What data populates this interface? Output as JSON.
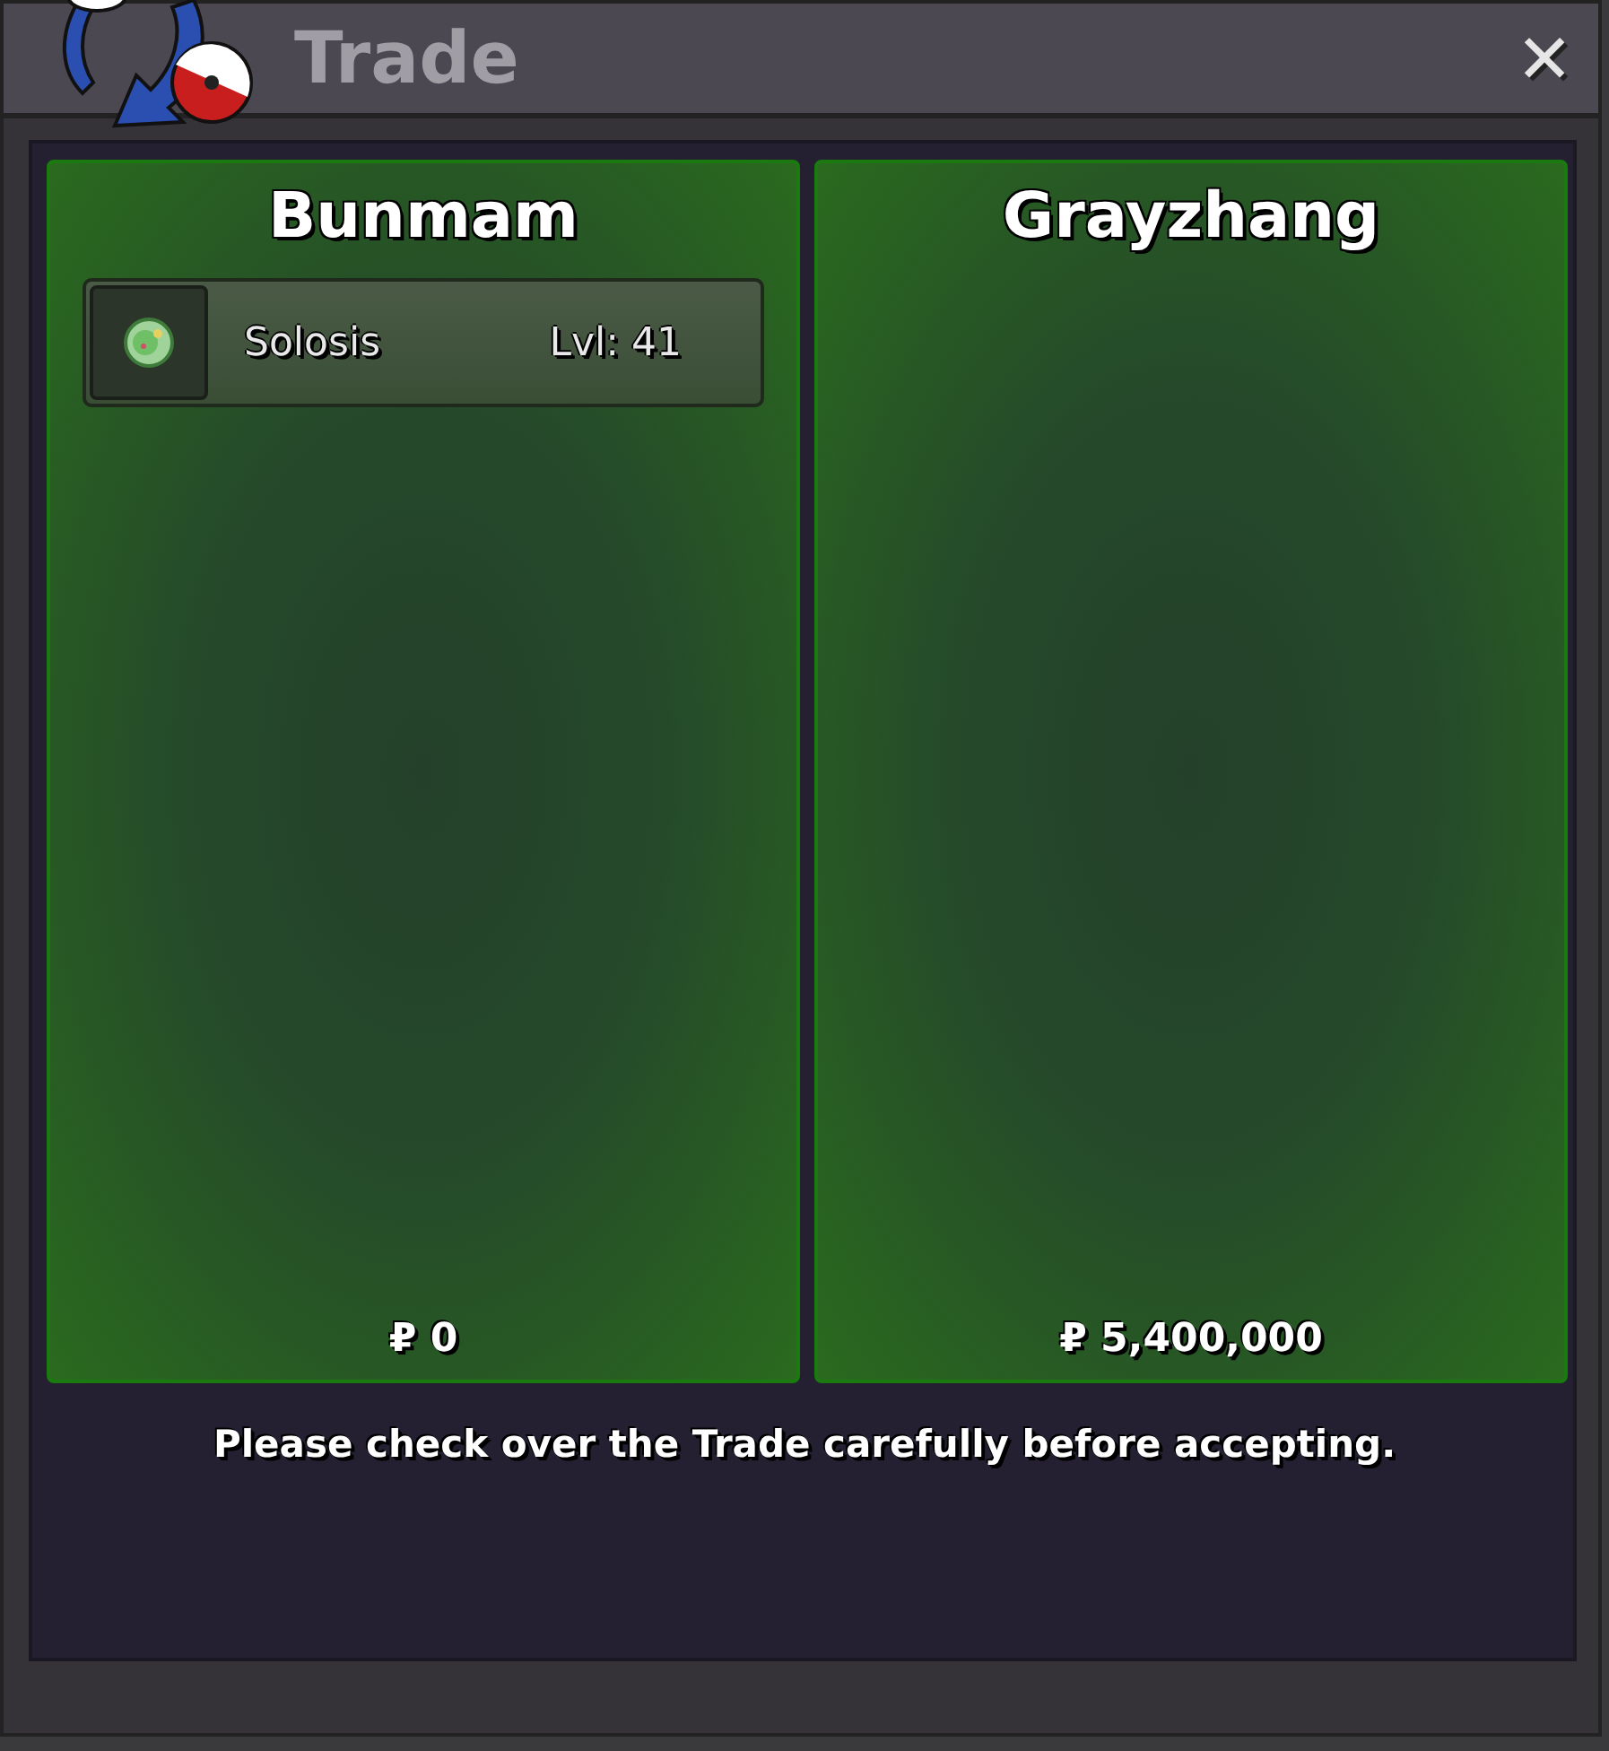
{
  "window": {
    "title": "Trade",
    "close": "✕"
  },
  "panels": [
    {
      "player": "Bunmam",
      "pokemon": [
        {
          "name": "Solosis",
          "level": "Lvl: 41"
        }
      ],
      "money": "₽ 0"
    },
    {
      "player": "Grayzhang",
      "money": "₽ 5,400,000"
    }
  ],
  "message": "Please check over the Trade carefully before accepting."
}
